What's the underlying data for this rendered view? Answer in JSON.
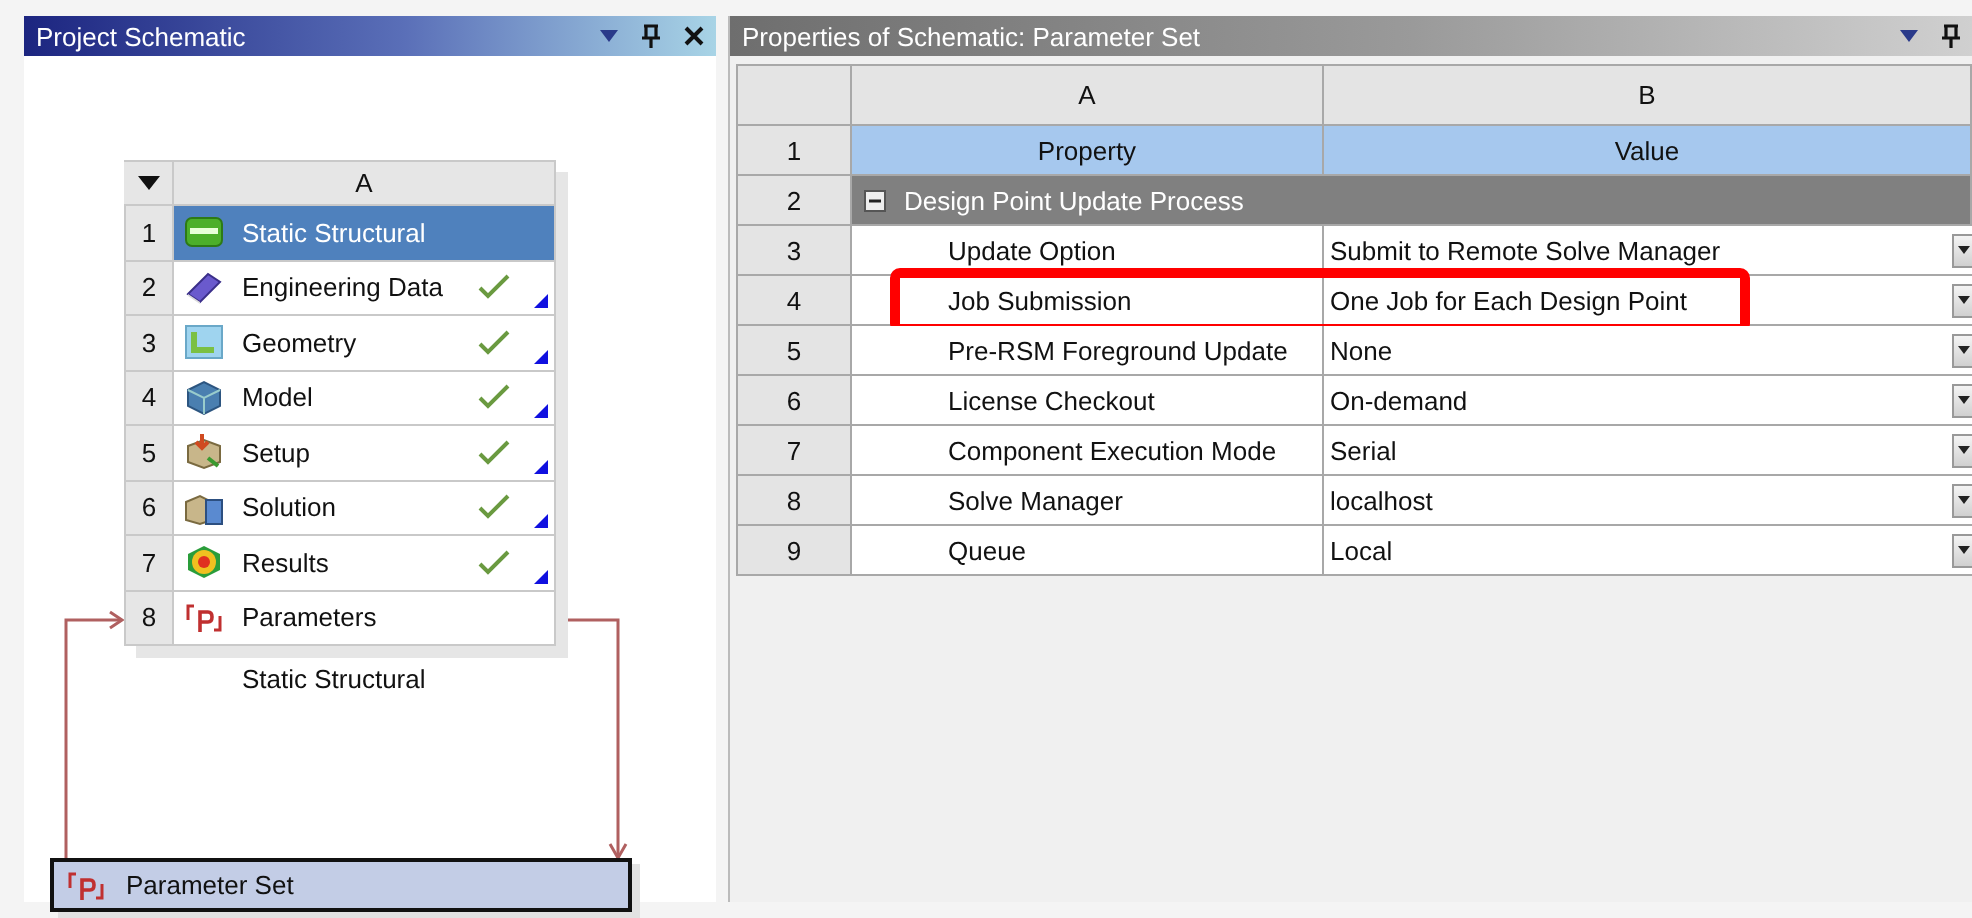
{
  "schematic": {
    "title": "Project Schematic",
    "system": {
      "column": "A",
      "rows": [
        {
          "number": "1",
          "label": "Static Structural",
          "kind": "system",
          "selected": true,
          "up_to_date": false
        },
        {
          "number": "2",
          "label": "Engineering Data",
          "kind": "engineering-data",
          "selected": false,
          "up_to_date": true
        },
        {
          "number": "3",
          "label": "Geometry",
          "kind": "geometry",
          "selected": false,
          "up_to_date": true
        },
        {
          "number": "4",
          "label": "Model",
          "kind": "model",
          "selected": false,
          "up_to_date": true
        },
        {
          "number": "5",
          "label": "Setup",
          "kind": "setup",
          "selected": false,
          "up_to_date": true
        },
        {
          "number": "6",
          "label": "Solution",
          "kind": "solution",
          "selected": false,
          "up_to_date": true
        },
        {
          "number": "7",
          "label": "Results",
          "kind": "results",
          "selected": false,
          "up_to_date": true
        },
        {
          "number": "8",
          "label": "Parameters",
          "kind": "parameters",
          "selected": false,
          "up_to_date": false
        }
      ],
      "caption": "Static Structural"
    },
    "parameter_set": {
      "label": "Parameter Set"
    }
  },
  "properties": {
    "title": "Properties of Schematic: Parameter Set",
    "columns": [
      "A",
      "B"
    ],
    "header": {
      "number": "1",
      "property": "Property",
      "value": "Value"
    },
    "group": {
      "number": "2",
      "label": "Design Point Update Process",
      "expanded": true
    },
    "rows": [
      {
        "number": "3",
        "property": "Update Option",
        "value": "Submit to Remote Solve Manager",
        "highlighted": false
      },
      {
        "number": "4",
        "property": "Job Submission",
        "value": "One Job for Each Design Point",
        "highlighted": true
      },
      {
        "number": "5",
        "property": "Pre-RSM Foreground Update",
        "value": "None",
        "highlighted": false
      },
      {
        "number": "6",
        "property": "License Checkout",
        "value": "On-demand",
        "highlighted": false
      },
      {
        "number": "7",
        "property": "Component Execution Mode",
        "value": "Serial",
        "highlighted": false
      },
      {
        "number": "8",
        "property": "Solve Manager",
        "value": "localhost",
        "highlighted": false
      },
      {
        "number": "9",
        "property": "Queue",
        "value": "Local",
        "highlighted": false
      }
    ]
  }
}
